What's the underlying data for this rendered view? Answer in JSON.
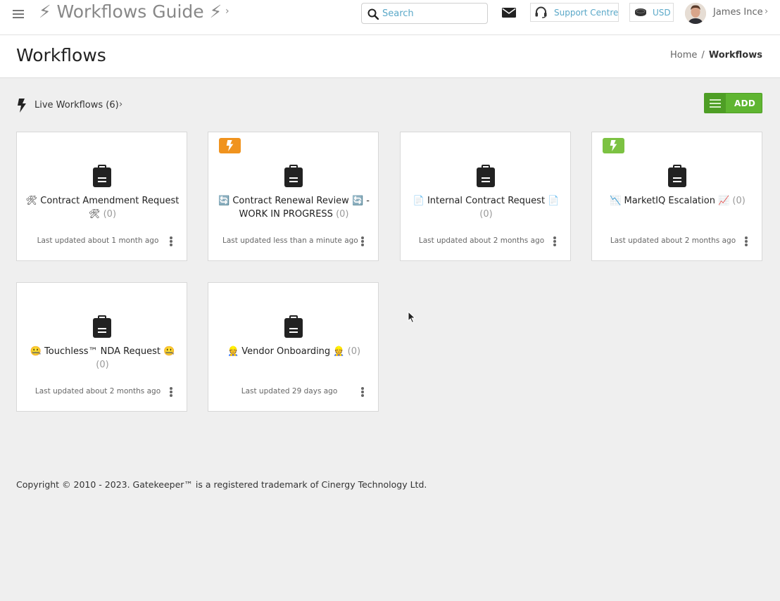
{
  "app": {
    "title": "⚡ Workflows Guide ⚡",
    "search_placeholder": "Search",
    "support_label": "Support Centre",
    "currency_label": "USD",
    "user_name": "James Ince"
  },
  "page": {
    "title": "Workflows",
    "breadcrumb": {
      "home": "Home",
      "separator": "/",
      "current": "Workflows"
    }
  },
  "section": {
    "live_label": "Live Workflows (6)",
    "add_label": "ADD"
  },
  "cards": [
    {
      "name": "🛠 Contract Amendment Request 🛠",
      "count": "(0)",
      "updated": "Last updated about 1 month ago",
      "badge": ""
    },
    {
      "name": "🔄 Contract Renewal Review 🔄 - WORK IN PROGRESS",
      "count": "(0)",
      "updated": "Last updated less than a minute ago",
      "badge": "orange-bolt"
    },
    {
      "name": "📄 Internal Contract Request 📄",
      "count": "(0)",
      "updated": "Last updated about 2 months ago",
      "badge": ""
    },
    {
      "name": "📉 MarketIQ Escalation 📈",
      "count": "(0)",
      "updated": "Last updated about 2 months ago",
      "badge": "green-bolt"
    },
    {
      "name": "🤐 Touchless™ NDA Request 🤐",
      "count": "(0)",
      "updated": "Last updated about 2 months ago",
      "badge": ""
    },
    {
      "name": "👷 Vendor Onboarding 👷",
      "count": "(0)",
      "updated": "Last updated 29 days ago",
      "badge": ""
    }
  ],
  "footer": "Copyright © 2010 - 2023. Gatekeeper™ is a registered trademark of Cinergy Technology Ltd.",
  "colors": {
    "accent_green": "#5fb531",
    "badge_orange": "#f0931e",
    "badge_green": "#7cc242",
    "link_blue": "#5aa8c8"
  }
}
